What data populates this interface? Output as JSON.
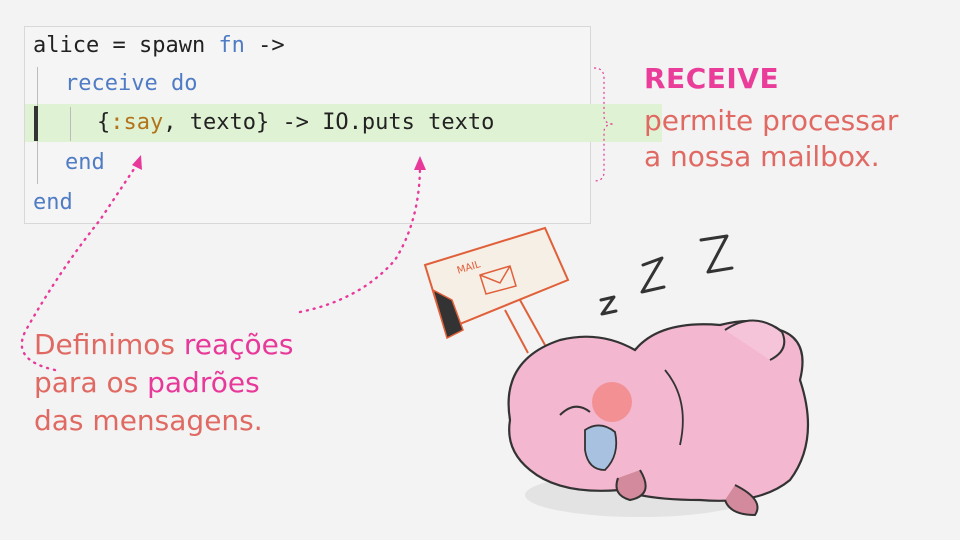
{
  "code": {
    "line1": {
      "a": "alice = spawn ",
      "kw": "fn",
      "b": " ->"
    },
    "line2": {
      "kw1": "receive",
      "kw2": "do"
    },
    "line3": {
      "brace_open": "{",
      "atom": ":say",
      "mid": ", texto} -> ",
      "mod": "IO",
      "rest": ".puts texto"
    },
    "line4": {
      "kw": "end"
    },
    "line5": {
      "kw": "end"
    }
  },
  "right_note": {
    "title": "RECEIVE",
    "line1": "permite processar",
    "line2": "a nossa mailbox."
  },
  "left_note": {
    "line1_a": "Definimos ",
    "line1_b": "reações",
    "line2_a": "para os ",
    "line2_b": "padrões",
    "line3": "das mensagens."
  },
  "illustration": {
    "sign_text": "MAIL",
    "sleep_letters": [
      "z",
      "Z",
      "Z"
    ]
  }
}
